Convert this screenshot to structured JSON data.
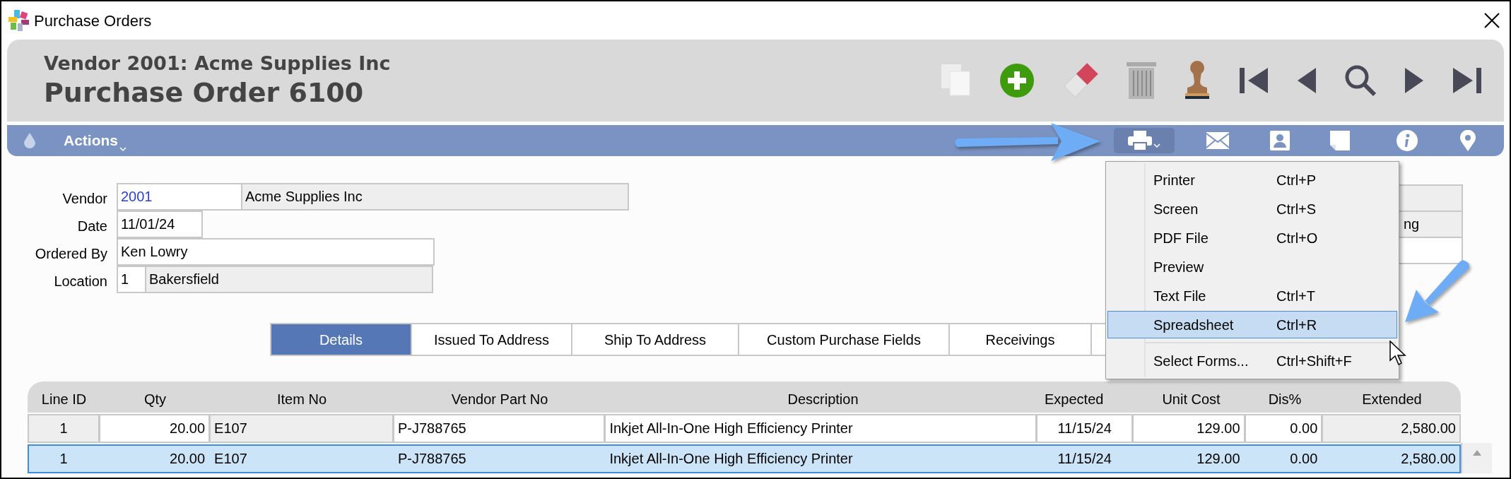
{
  "window": {
    "title": "Purchase Orders"
  },
  "header": {
    "vendor_line": "Vendor 2001: Acme Supplies Inc",
    "title": "Purchase Order 6100"
  },
  "action_bar": {
    "actions_label": "Actions",
    "print_expanded": true
  },
  "form": [
    {
      "label": "Vendor",
      "values": [
        {
          "text": "2001",
          "kind": "link"
        },
        {
          "text": "Acme Supplies Inc",
          "kind": "readonly"
        }
      ]
    },
    {
      "label": "Date",
      "values": [
        {
          "text": "11/01/24",
          "kind": "input"
        }
      ]
    },
    {
      "label": "Ordered By",
      "values": [
        {
          "text": "Ken Lowry",
          "kind": "input"
        }
      ]
    },
    {
      "label": "Location",
      "values": [
        {
          "text": "1",
          "kind": "input"
        },
        {
          "text": "Bakersfield",
          "kind": "readonly"
        }
      ]
    }
  ],
  "side_field": {
    "value": "ng"
  },
  "tabs": [
    {
      "label": "Details",
      "selected": true
    },
    {
      "label": "Issued To Address",
      "selected": false
    },
    {
      "label": "Ship To Address",
      "selected": false
    },
    {
      "label": "Custom Purchase Fields",
      "selected": false
    },
    {
      "label": "Receivings",
      "selected": false
    }
  ],
  "print_menu": [
    {
      "kind": "item",
      "label": "Printer",
      "shortcut": "Ctrl+P",
      "selected": false
    },
    {
      "kind": "item",
      "label": "Screen",
      "shortcut": "Ctrl+S",
      "selected": false
    },
    {
      "kind": "item",
      "label": "PDF File",
      "shortcut": "Ctrl+O",
      "selected": false
    },
    {
      "kind": "item",
      "label": "Preview",
      "selected": false
    },
    {
      "kind": "item",
      "label": "Text File",
      "shortcut": "Ctrl+T",
      "selected": false
    },
    {
      "kind": "item",
      "label": "Spreadsheet",
      "shortcut": "Ctrl+R",
      "selected": true
    },
    {
      "kind": "separator"
    },
    {
      "kind": "item",
      "label": "Select Forms...",
      "shortcut": "Ctrl+Shift+F",
      "selected": false
    }
  ],
  "table": {
    "columns": [
      "Line ID",
      "Qty",
      "Item No",
      "Vendor Part No",
      "Description",
      "Expected",
      "Unit Cost",
      "Dis%",
      "Extended"
    ],
    "rows": [
      {
        "selected": false,
        "cells": [
          "1",
          "20.00",
          "E107",
          "P-J788765",
          "Inkjet All-In-One High Efficiency Printer",
          "11/15/24",
          "129.00",
          "0.00",
          "2,580.00"
        ]
      },
      {
        "selected": true,
        "cells": [
          "1",
          "20.00",
          "E107",
          "P-J788765",
          "Inkjet All-In-One High Efficiency Printer",
          "11/15/24",
          "129.00",
          "0.00",
          "2,580.00"
        ]
      }
    ]
  }
}
